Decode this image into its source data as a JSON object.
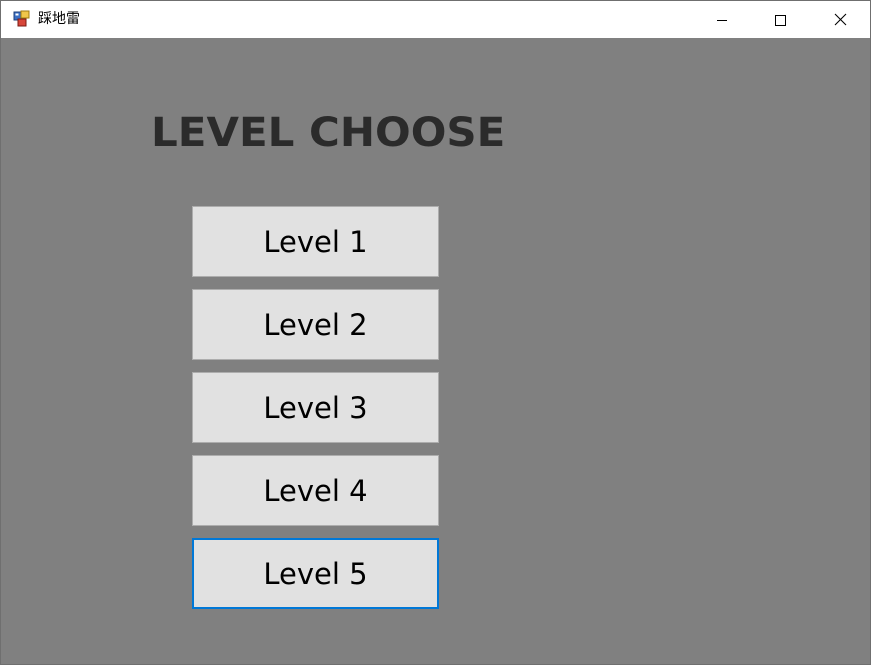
{
  "window": {
    "title": "踩地雷",
    "controls": {
      "minimize_icon": "minimize-icon",
      "maximize_icon": "maximize-icon",
      "close_icon": "close-icon"
    }
  },
  "main": {
    "heading": "LEVEL CHOOSE",
    "levels": [
      {
        "label": "Level 1"
      },
      {
        "label": "Level 2"
      },
      {
        "label": "Level 3"
      },
      {
        "label": "Level 4"
      },
      {
        "label": "Level 5",
        "focused": true
      }
    ]
  },
  "colors": {
    "background": "#808080",
    "button_face": "#e1e1e1",
    "focus_border": "#0078d7",
    "heading": "#2b2b2b"
  }
}
